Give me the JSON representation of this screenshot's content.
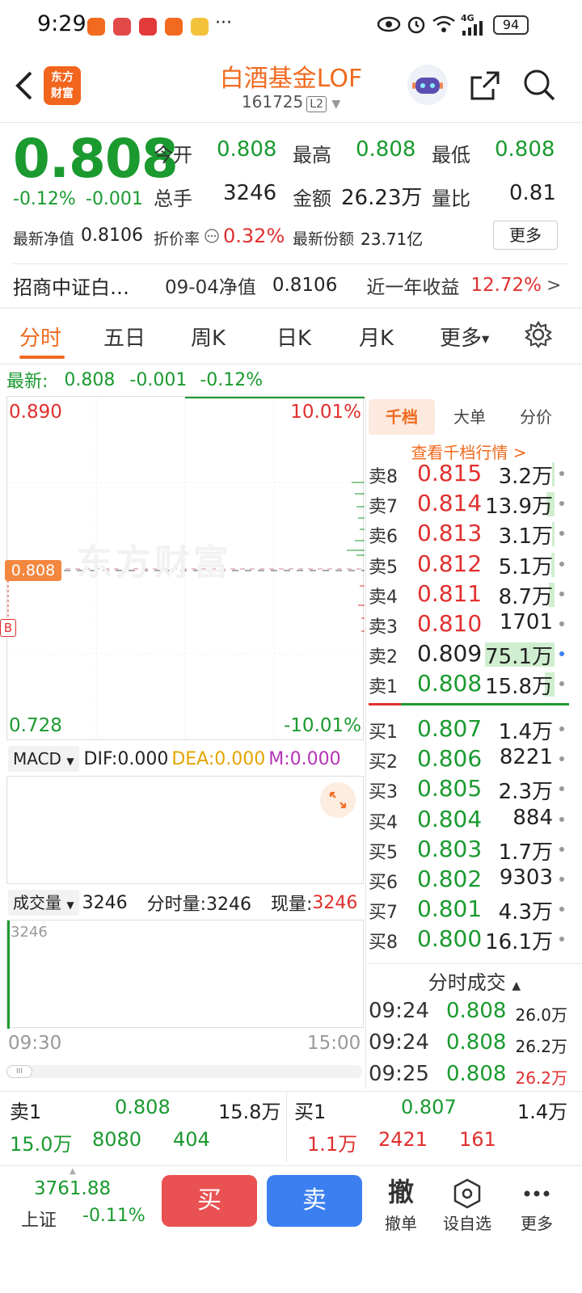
{
  "status": {
    "time": "9:29",
    "more": "···",
    "battery": "94",
    "network": "4G"
  },
  "header": {
    "brand_line1": "东方",
    "brand_line2": "财富",
    "title": "白酒基金LOF",
    "code": "161725",
    "level": "L2"
  },
  "quote": {
    "price": "0.808",
    "change_pct": "-0.12%",
    "change": "-0.001",
    "open_label": "今开",
    "open": "0.808",
    "high_label": "最高",
    "high": "0.808",
    "low_label": "最低",
    "low": "0.808",
    "volume_label": "总手",
    "volume": "3246",
    "amount_label": "金额",
    "amount": "26.23万",
    "ratio_label": "量比",
    "ratio": "0.81",
    "nav_label": "最新净值",
    "nav": "0.8106",
    "discount_label": "折价率",
    "discount": "0.32%",
    "shares_label": "最新份额",
    "shares": "23.71亿",
    "more_button": "更多"
  },
  "fund_row": {
    "name": "招商中证白…",
    "nav_date_label": "09-04净值",
    "nav_value": "0.8106",
    "year_return_label": "近一年收益",
    "year_return": "12.72%",
    "arrow": ">"
  },
  "tabs": [
    "分时",
    "五日",
    "周K",
    "日K",
    "月K",
    "更多"
  ],
  "latest": {
    "label": "最新:",
    "price": "0.808",
    "change": "-0.001",
    "pct": "-0.12%"
  },
  "chart": {
    "upper_price": "0.890",
    "upper_pct": "10.01%",
    "lower_price": "0.728",
    "lower_pct": "-10.01%",
    "current_tag": "0.808",
    "b_tag": "B",
    "watermark": "东方财富",
    "macd_label": "MACD",
    "dif": "DIF:0.000",
    "dea": "DEA:0.000",
    "m": "M:0.000",
    "vol_label": "成交量",
    "vol_value": "3246",
    "vol_period_label": "分时量:3246",
    "vol_now_label": "现量:",
    "vol_now": "3246",
    "vol_axis_max": "3246",
    "time_start": "09:30",
    "time_end": "15:00",
    "scroll_handle": "III"
  },
  "orderbook": {
    "tabs": [
      "千档",
      "大单",
      "分价"
    ],
    "link": "查看千档行情 >",
    "asks": [
      {
        "side": "卖8",
        "price": "0.815",
        "vol": "3.2万",
        "fill": 0.03
      },
      {
        "side": "卖7",
        "price": "0.814",
        "vol": "13.9万",
        "fill": 0.12
      },
      {
        "side": "卖6",
        "price": "0.813",
        "vol": "3.1万",
        "fill": 0.03
      },
      {
        "side": "卖5",
        "price": "0.812",
        "vol": "5.1万",
        "fill": 0.05
      },
      {
        "side": "卖4",
        "price": "0.811",
        "vol": "8.7万",
        "fill": 0.08
      },
      {
        "side": "卖3",
        "price": "0.810",
        "vol": "1701",
        "fill": 0.0
      },
      {
        "side": "卖2",
        "price": "0.809",
        "vol": "75.1万",
        "fill": 1.0
      },
      {
        "side": "卖1",
        "price": "0.808",
        "vol": "15.8万",
        "fill": 0.14
      }
    ],
    "bids": [
      {
        "side": "买1",
        "price": "0.807",
        "vol": "1.4万"
      },
      {
        "side": "买2",
        "price": "0.806",
        "vol": "8221"
      },
      {
        "side": "买3",
        "price": "0.805",
        "vol": "2.3万"
      },
      {
        "side": "买4",
        "price": "0.804",
        "vol": "884"
      },
      {
        "side": "买5",
        "price": "0.803",
        "vol": "1.7万"
      },
      {
        "side": "买6",
        "price": "0.802",
        "vol": "9303"
      },
      {
        "side": "买7",
        "price": "0.801",
        "vol": "4.3万"
      },
      {
        "side": "买8",
        "price": "0.800",
        "vol": "16.1万"
      }
    ],
    "ticks_label": "分时成交",
    "ticks": [
      {
        "time": "09:24",
        "price": "0.808",
        "vol": "26.0万"
      },
      {
        "time": "09:24",
        "price": "0.808",
        "vol": "26.2万"
      },
      {
        "time": "09:25",
        "price": "0.808",
        "vol": "26.2万"
      }
    ]
  },
  "summary": {
    "sell_label": "卖1",
    "sell_price": "0.808",
    "sell_vol": "15.8万",
    "buy_label": "买1",
    "buy_price": "0.807",
    "buy_vol": "1.4万",
    "sell_a": "15.0万",
    "sell_b": "8080",
    "sell_c": "404",
    "buy_a": "1.1万",
    "buy_b": "2421",
    "buy_c": "161"
  },
  "footer": {
    "index_value": "3761.88",
    "index_name": "上证",
    "index_change": "-0.11%",
    "buy": "买",
    "sell": "卖",
    "cancel_icon_char": "撤",
    "cancel": "撤单",
    "watchlist": "设自选",
    "more": "更多"
  }
}
